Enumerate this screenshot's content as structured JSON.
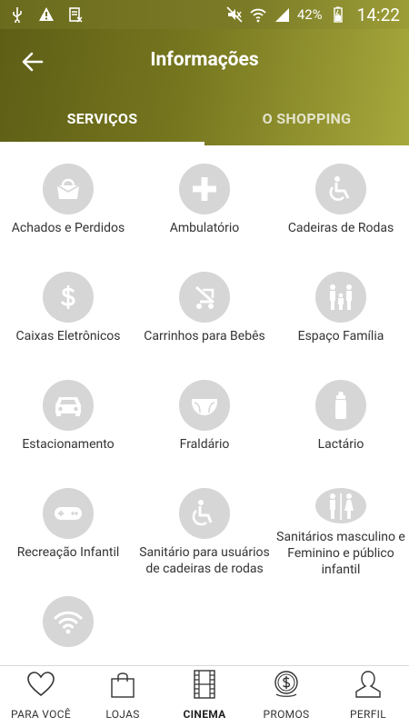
{
  "status_bar": {
    "battery": "42%",
    "time": "14:22"
  },
  "header": {
    "title": "Informações",
    "tabs": [
      {
        "label": "SERVIÇOS",
        "active": true
      },
      {
        "label": "O SHOPPING",
        "active": false
      }
    ]
  },
  "services": [
    {
      "label": "Achados e Perdidos",
      "icon": "bag-icon"
    },
    {
      "label": "Ambulatório",
      "icon": "plus-icon"
    },
    {
      "label": "Cadeiras de Rodas",
      "icon": "wheelchair-icon"
    },
    {
      "label": "Caixas Eletrônicos",
      "icon": "dollar-icon"
    },
    {
      "label": "Carrinhos para Bebês",
      "icon": "stroller-icon"
    },
    {
      "label": "Espaço Família",
      "icon": "family-icon"
    },
    {
      "label": "Estacionamento",
      "icon": "car-icon"
    },
    {
      "label": "Fraldário",
      "icon": "diaper-icon"
    },
    {
      "label": "Lactário",
      "icon": "baby-bottle-icon"
    },
    {
      "label": "Recreação Infantil",
      "icon": "gamepad-icon"
    },
    {
      "label": "Sanitário para usuários de cadeiras de rodas",
      "icon": "accessible-restroom-icon"
    },
    {
      "label": "Sanitários masculino e Feminino e público infantil",
      "icon": "restroom-icon"
    },
    {
      "label": "",
      "icon": "wifi-icon"
    }
  ],
  "bottom_nav": [
    {
      "label": "PARA VOCÊ",
      "icon": "heart-icon"
    },
    {
      "label": "LOJAS",
      "icon": "shopping-bag-icon"
    },
    {
      "label": "CINEMA",
      "icon": "film-icon",
      "active": true
    },
    {
      "label": "PROMOS",
      "icon": "coin-icon"
    },
    {
      "label": "PERFIL",
      "icon": "user-icon"
    }
  ],
  "colors": {
    "header_dark": "#5e5e16",
    "header_light": "#a7a83c",
    "icon_circle": "#d6d6d6"
  }
}
